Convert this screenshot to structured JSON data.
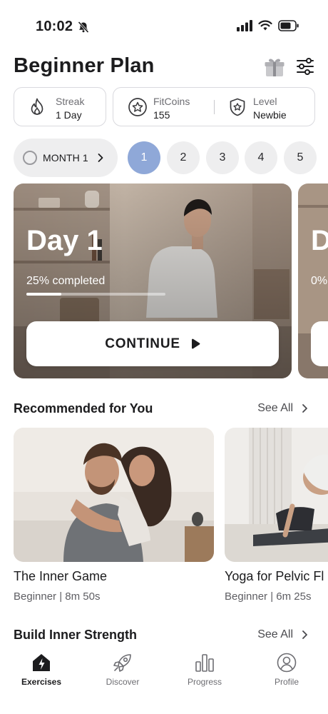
{
  "status_bar": {
    "time": "10:02"
  },
  "header": {
    "title": "Beginner Plan"
  },
  "stats": {
    "streak": {
      "label": "Streak",
      "value": "1 Day"
    },
    "fitcoins": {
      "label": "FitCoins",
      "value": "155"
    },
    "level": {
      "label": "Level",
      "value": "Newbie"
    }
  },
  "month": {
    "label": "MONTH 1"
  },
  "days": [
    "1",
    "2",
    "3",
    "4",
    "5"
  ],
  "plan_card": {
    "day_title": "Day 1",
    "progress_text": "25% completed",
    "progress": 0.25,
    "continue_label": "CONTINUE"
  },
  "plan_card_next": {
    "day_title": "D",
    "progress_text": "0%"
  },
  "recommended": {
    "title": "Recommended for You",
    "see_all": "See All",
    "items": [
      {
        "title": "The Inner Game",
        "meta": "Beginner | 8m 50s"
      },
      {
        "title": "Yoga for Pelvic Fl",
        "meta": "Beginner | 6m 25s"
      }
    ]
  },
  "build_strength": {
    "title": "Build Inner Strength",
    "see_all": "See All"
  },
  "nav": {
    "items": [
      {
        "label": "Exercises",
        "icon": "exercises-icon"
      },
      {
        "label": "Discover",
        "icon": "rocket-icon"
      },
      {
        "label": "Progress",
        "icon": "bar-chart-icon"
      },
      {
        "label": "Profile",
        "icon": "profile-icon"
      }
    ]
  },
  "colors": {
    "accent_day": "#8fa8d8",
    "pill_bg": "#eeeeef",
    "border": "#d9d9de"
  }
}
